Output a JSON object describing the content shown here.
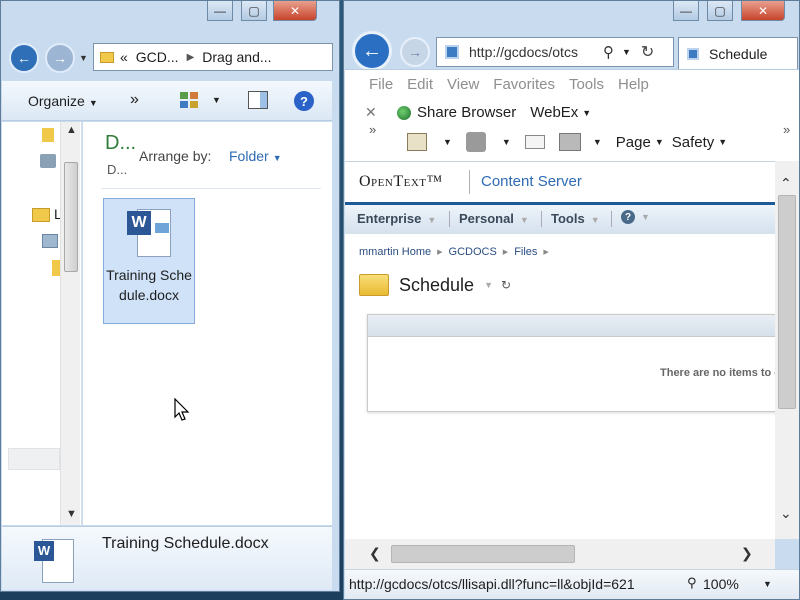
{
  "explorer": {
    "address": {
      "prefix": "«",
      "segments": [
        "GCD...",
        "Drag and..."
      ]
    },
    "toolbar": {
      "organize": "Organize",
      "more": "»"
    },
    "header": {
      "title": "D...",
      "subtitle": "D...",
      "arrange_label": "Arrange by:",
      "arrange_value": "Folder"
    },
    "sidebar": {
      "partial_label": "L"
    },
    "file": {
      "name": "Training Schedule.docx"
    },
    "details": {
      "name": "Training Schedule.docx"
    }
  },
  "ie": {
    "address": "http://gcdocs/otcs",
    "tab": "Schedule",
    "menu": [
      "File",
      "Edit",
      "View",
      "Favorites",
      "Tools",
      "Help"
    ],
    "links": {
      "share": "Share Browser",
      "webex": "WebEx"
    },
    "commands": {
      "page": "Page",
      "safety": "Safety"
    },
    "status": {
      "url": "http://gcdocs/otcs/llisapi.dll?func=ll&objId=621",
      "zoom": "100%"
    }
  },
  "opentext": {
    "brand": "OpenText™",
    "product": "Content Server",
    "nav": [
      "Enterprise",
      "Personal",
      "Tools"
    ],
    "breadcrumb": [
      "mmartin Home",
      "GCDOCS",
      "Files"
    ],
    "folder_title": "Schedule",
    "empty_text": "There are no items to display."
  },
  "colors": {
    "explorer_accent": "#2f7d3a",
    "link": "#2d6bb3",
    "ie_frame": "#c9dcef"
  }
}
